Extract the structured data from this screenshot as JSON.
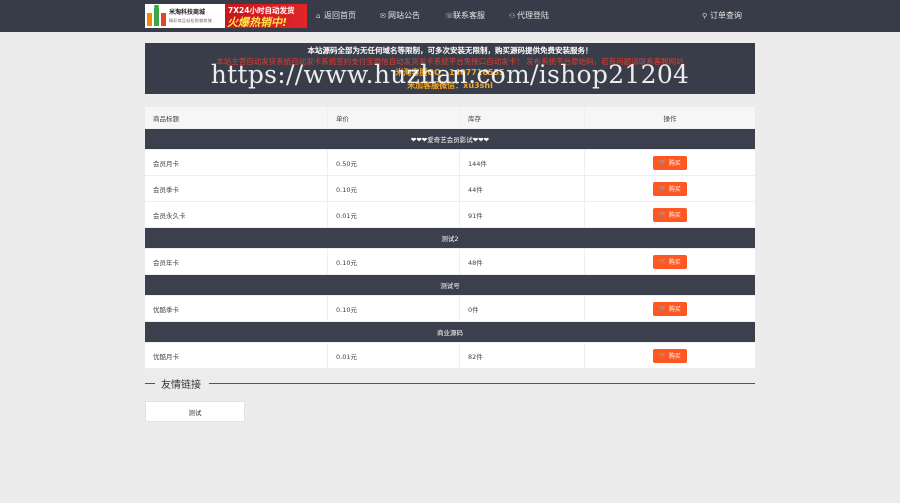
{
  "header": {
    "logo": {
      "name": "米淘科技商城",
      "slogan": "精彩商品轻松购物商城",
      "promo_line1": "7X24小时自动发货",
      "promo_line2": "火爆热销中!"
    },
    "nav": [
      {
        "icon": "home-icon",
        "label": "返回首页"
      },
      {
        "icon": "announce-icon",
        "label": "网站公告"
      },
      {
        "icon": "service-icon",
        "label": "联系客服"
      },
      {
        "icon": "login-icon",
        "label": "代理登陆"
      }
    ],
    "order_query": {
      "icon": "query-icon",
      "label": "订单查询"
    }
  },
  "banner": {
    "line1": "本站源码全部为无任何域名等限制，可多次安装无限制，购买源码提供免费安装服务！",
    "line2": "本站主营自动发货系统自动发卡系统签约支付宝微信自动发货发卡系统平台免接口自动发卡！ 发布系统平台原始码，若有问题请联系客服网站",
    "line3": "米淘客服QQ：1407716555",
    "line4": "米加客服微信：xu3shi",
    "watermark": "https://www.huzhan.com/ishop21204"
  },
  "table": {
    "headers": [
      "商品标题",
      "单价",
      "库存",
      "操作"
    ],
    "buy_label": "购买",
    "groups": [
      {
        "name": "❤❤❤爱奇艺会员影试❤❤❤",
        "items": [
          {
            "title": "会员月卡",
            "price": "0.50元",
            "stock": "144件"
          },
          {
            "title": "会员季卡",
            "price": "0.10元",
            "stock": "44件"
          },
          {
            "title": "会员永久卡",
            "price": "0.01元",
            "stock": "91件"
          }
        ]
      },
      {
        "name": "测试2",
        "items": [
          {
            "title": "会员年卡",
            "price": "0.10元",
            "stock": "48件"
          }
        ]
      },
      {
        "name": "测试号",
        "items": [
          {
            "title": "优酷季卡",
            "price": "0.10元",
            "stock": "0件"
          }
        ]
      },
      {
        "name": "商业源码",
        "items": [
          {
            "title": "优酷月卡",
            "price": "0.01元",
            "stock": "82件"
          }
        ]
      }
    ]
  },
  "links": {
    "title": "友情链接",
    "items": [
      "测试"
    ]
  },
  "colors": {
    "topbar": "#383c48",
    "group_header": "#3c404d",
    "buy_button": "#ff5722",
    "page_bg": "#ececec"
  }
}
